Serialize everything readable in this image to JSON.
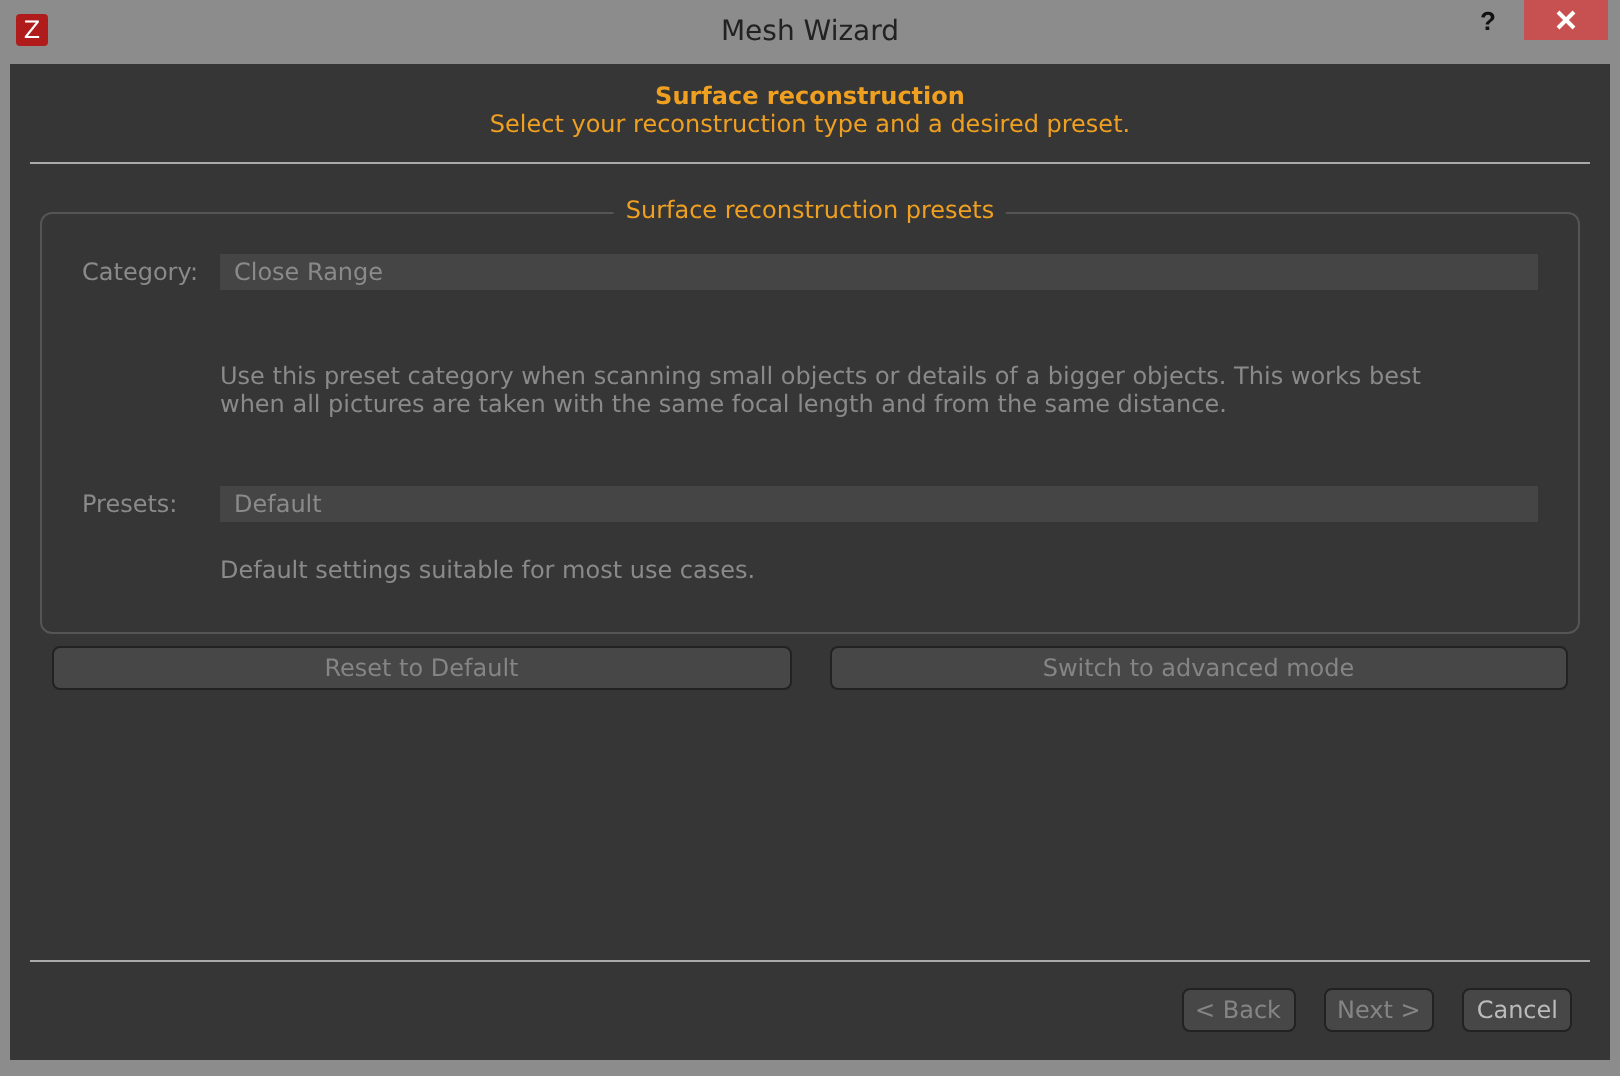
{
  "window": {
    "title": "Mesh Wizard",
    "app_icon": "Z",
    "help": "?"
  },
  "header": {
    "title": "Surface reconstruction",
    "subtitle": "Select your reconstruction type and a desired preset."
  },
  "group": {
    "title": "Surface reconstruction presets",
    "category": {
      "label": "Category:",
      "value": "Close Range",
      "description": "Use this preset category when scanning small objects or details of a bigger objects. This works best when all pictures are taken with the same focal length and from the same distance."
    },
    "presets": {
      "label": "Presets:",
      "value": "Default",
      "description": "Default settings suitable for most use cases."
    }
  },
  "actions": [
    {
      "label": "Reset to Default",
      "disabled": true
    },
    {
      "label": "Switch to advanced mode",
      "disabled": true
    }
  ],
  "footer": [
    {
      "label": "< Back",
      "disabled": true
    },
    {
      "label": "Next >",
      "disabled": true
    },
    {
      "label": "Cancel",
      "disabled": false
    }
  ]
}
